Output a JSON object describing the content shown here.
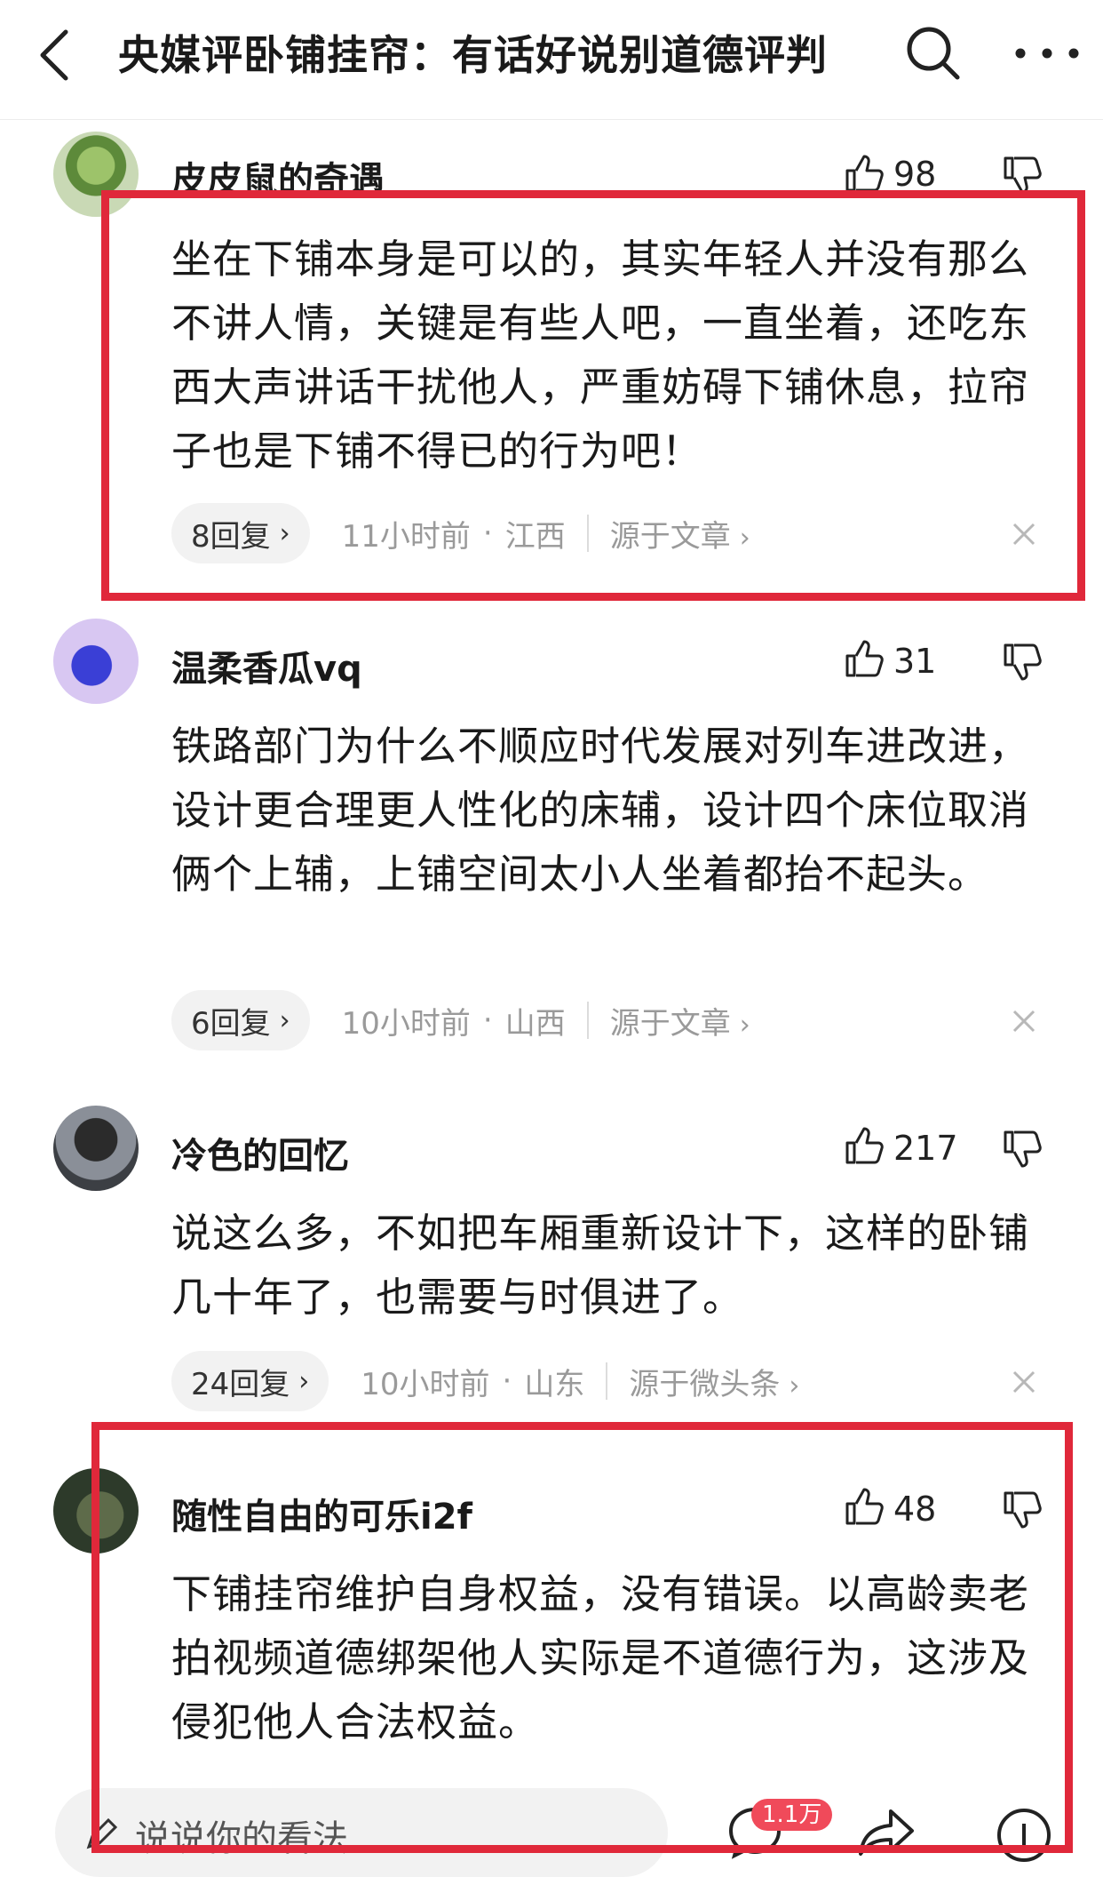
{
  "header": {
    "title": "央媒评卧铺挂帘：有话好说别道德评判"
  },
  "comments": [
    {
      "username": "皮皮鼠的奇遇",
      "likes": "98",
      "text": "坐在下铺本身是可以的，其实年轻人并没有那么不讲人情，关键是有些人吧，一直坐着，还吃东西大声讲话干扰他人，严重妨碍下铺休息，拉帘子也是下铺不得已的行为吧！",
      "replies": "8回复",
      "time": "11小时前",
      "location": "江西",
      "source": "源于文章"
    },
    {
      "username": "温柔香瓜vq",
      "likes": "31",
      "text": "铁路部门为什么不顺应时代发展对列车进改进，设计更合理更人性化的床辅，设计四个床位取消俩个上辅，上铺空间太小人坐着都抬不起头。",
      "replies": "6回复",
      "time": "10小时前",
      "location": "山西",
      "source": "源于文章"
    },
    {
      "username": "冷色的回忆",
      "likes": "217",
      "text": "说这么多，不如把车厢重新设计下，这样的卧铺几十年了，也需要与时俱进了。",
      "replies": "24回复",
      "time": "10小时前",
      "location": "山东",
      "source": "源于微头条"
    },
    {
      "username": "随性自由的可乐i2f",
      "likes": "48",
      "text": "下铺挂帘维护自身权益，没有错误。以高龄卖老拍视频道德绑架他人实际是不道德行为，这涉及侵犯他人合法权益。"
    }
  ],
  "bottom_bar": {
    "input_placeholder": "说说你的看法...",
    "comment_count_badge": "1.1万"
  },
  "colors": {
    "highlight": "#e0283a",
    "badge": "#f04a5a",
    "meta_text": "#9a9a9a"
  },
  "icons": [
    "back-icon",
    "search-icon",
    "more-icon",
    "like-icon",
    "dislike-icon",
    "close-icon",
    "pen-icon",
    "comments-icon",
    "share-icon",
    "info-icon"
  ]
}
